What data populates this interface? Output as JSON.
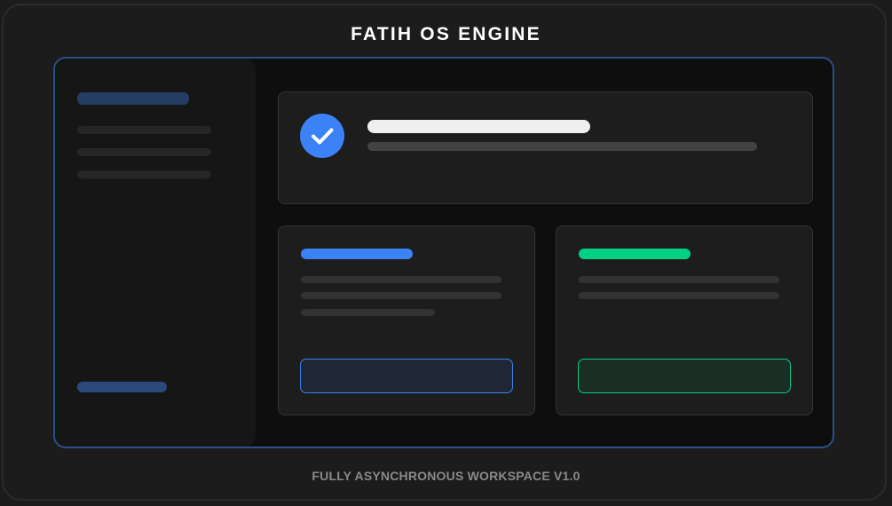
{
  "app": {
    "title": "FATIH OS ENGINE",
    "footer": "FULLY ASYNCHRONOUS WORKSPACE V1.0"
  },
  "colors": {
    "accent_blue": "#3b82f6",
    "accent_green": "#00d084",
    "window_border": "#2b4f86",
    "card_bg": "#1d1d1d",
    "page_bg": "#1c1c1c"
  },
  "icons": {
    "status": "check-icon"
  }
}
